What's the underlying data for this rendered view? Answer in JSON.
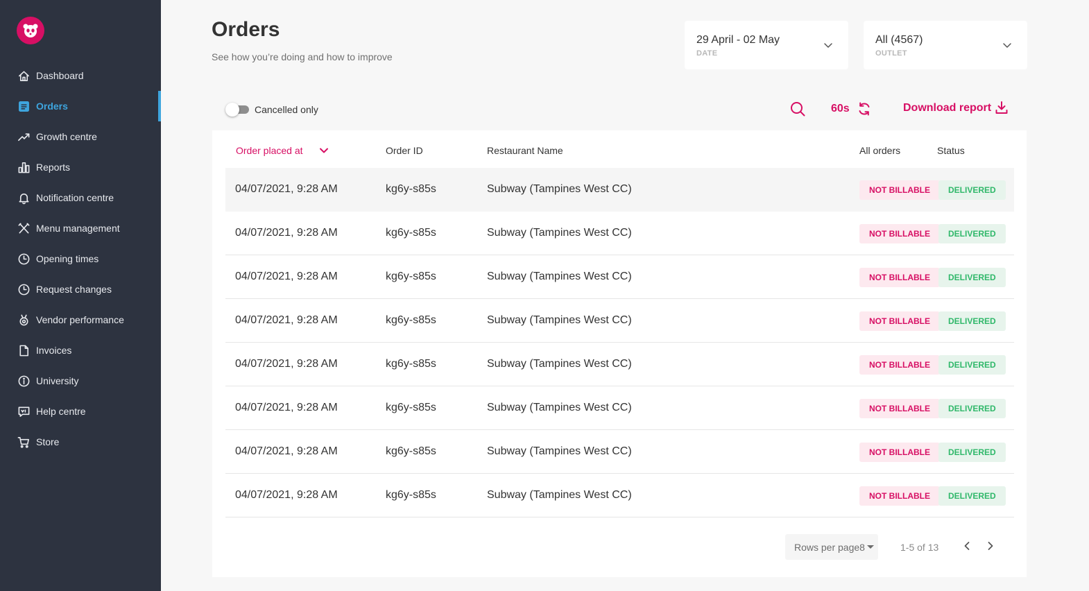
{
  "sidebar": {
    "logo_icon": "panda-logo-icon",
    "items": [
      {
        "label": "Dashboard",
        "icon": "home-icon",
        "active": false
      },
      {
        "label": "Orders",
        "icon": "list-icon",
        "active": true
      },
      {
        "label": "Growth centre",
        "icon": "trend-icon",
        "active": false
      },
      {
        "label": "Reports",
        "icon": "bar-chart-icon",
        "active": false
      },
      {
        "label": "Notification centre",
        "icon": "bell-icon",
        "active": false
      },
      {
        "label": "Menu management",
        "icon": "utensils-icon",
        "active": false
      },
      {
        "label": "Opening times",
        "icon": "clock-icon",
        "active": false
      },
      {
        "label": "Request changes",
        "icon": "clock-icon",
        "active": false
      },
      {
        "label": "Vendor performance",
        "icon": "medal-icon",
        "active": false
      },
      {
        "label": "Invoices",
        "icon": "document-icon",
        "active": false
      },
      {
        "label": "University",
        "icon": "info-icon",
        "active": false
      },
      {
        "label": "Help centre",
        "icon": "chat-icon",
        "active": false
      },
      {
        "label": "Store",
        "icon": "cart-icon",
        "active": false
      }
    ]
  },
  "header": {
    "title": "Orders",
    "subtitle": "See how you’re doing and how to improve"
  },
  "filters": {
    "date": {
      "value": "29 April - 02 May",
      "label": "DATE"
    },
    "outlet": {
      "value": "All (4567)",
      "label": "OUTLET"
    }
  },
  "toolbar": {
    "cancelled_only_label": "Cancelled only",
    "cancelled_only_on": false,
    "refresh_interval": "60s",
    "download_label": "Download report"
  },
  "table": {
    "headers": {
      "order_placed_at": "Order placed at",
      "order_id": "Order ID",
      "restaurant_name": "Restaurant Name",
      "all_orders": "All orders",
      "status": "Status"
    },
    "rows": [
      {
        "date": "04/07/2021, 9:28 AM",
        "id": "kg6y-s85s",
        "restaurant": "Subway (Tampines West CC)",
        "billing": "NOT BILLABLE",
        "status": "DELIVERED"
      },
      {
        "date": "04/07/2021, 9:28 AM",
        "id": "kg6y-s85s",
        "restaurant": "Subway (Tampines West CC)",
        "billing": "NOT BILLABLE",
        "status": "DELIVERED"
      },
      {
        "date": "04/07/2021, 9:28 AM",
        "id": "kg6y-s85s",
        "restaurant": "Subway (Tampines West CC)",
        "billing": "NOT BILLABLE",
        "status": "DELIVERED"
      },
      {
        "date": "04/07/2021, 9:28 AM",
        "id": "kg6y-s85s",
        "restaurant": "Subway (Tampines West CC)",
        "billing": "NOT BILLABLE",
        "status": "DELIVERED"
      },
      {
        "date": "04/07/2021, 9:28 AM",
        "id": "kg6y-s85s",
        "restaurant": "Subway (Tampines West CC)",
        "billing": "NOT BILLABLE",
        "status": "DELIVERED"
      },
      {
        "date": "04/07/2021, 9:28 AM",
        "id": "kg6y-s85s",
        "restaurant": "Subway (Tampines West CC)",
        "billing": "NOT BILLABLE",
        "status": "DELIVERED"
      },
      {
        "date": "04/07/2021, 9:28 AM",
        "id": "kg6y-s85s",
        "restaurant": "Subway (Tampines West CC)",
        "billing": "NOT BILLABLE",
        "status": "DELIVERED"
      },
      {
        "date": "04/07/2021, 9:28 AM",
        "id": "kg6y-s85s",
        "restaurant": "Subway (Tampines West CC)",
        "billing": "NOT BILLABLE",
        "status": "DELIVERED"
      }
    ]
  },
  "pagination": {
    "rows_per_page_label": "Rows per page8",
    "range_text": "1-5 of 13"
  },
  "colors": {
    "brand": "#d70f64",
    "sidebar_bg": "#2d3340",
    "active_nav": "#3ea5de",
    "success": "#30b86a"
  }
}
